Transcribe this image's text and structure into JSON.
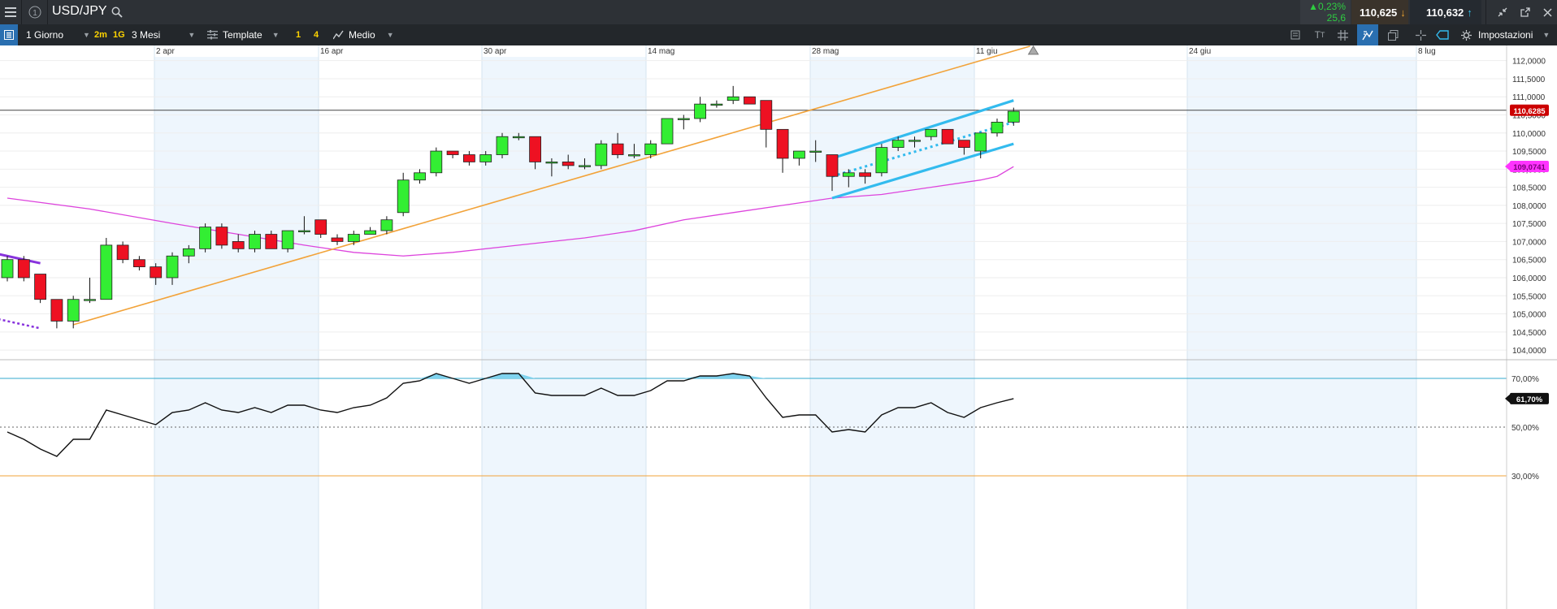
{
  "header": {
    "symbol": "USD/JPY",
    "change_pct": "▲0,23%",
    "change_pts": "25,6",
    "sell_price": "110,625",
    "buy_price": "110,632"
  },
  "toolbar": {
    "interval": "1 Giorno",
    "quick_2m": "2m",
    "quick_1g": "1G",
    "range": "3 Mesi",
    "template": "Template",
    "badge_1": "1",
    "badge_4": "4",
    "style": "Medio",
    "settings": "Impostazioni"
  },
  "icons": [
    "menu-icon",
    "info-icon",
    "search-icon",
    "list-icon",
    "template-icon",
    "chart-style-icon",
    "text-icon",
    "grid-icon",
    "draw-icon",
    "copy-icon",
    "crosshair-icon",
    "label-icon",
    "gear-icon",
    "minimize-icon",
    "popout-icon",
    "close-icon"
  ],
  "colors": {
    "up_candle": "#33ee33",
    "down_candle": "#ee1122",
    "trendline": "#f2a33a",
    "moving_average": "#dd44dd",
    "channel": "#33bbee",
    "price_label": "#cc0000",
    "ma_label": "#ff33ff",
    "oscillator": "#111111",
    "shade": "#eef6fd"
  },
  "chart_data": {
    "type": "candlestick",
    "symbol": "USD/JPY",
    "x_labels": [
      "2 apr",
      "16 apr",
      "30 apr",
      "14 mag",
      "28 mag",
      "11 giu",
      "24 giu",
      "8 lug"
    ],
    "y_ticks": [
      "112,0000",
      "111,5000",
      "111,0000",
      "110,5000",
      "110,0000",
      "109,5000",
      "109,0000",
      "108,5000",
      "108,0000",
      "107,5000",
      "107,0000",
      "106,5000",
      "106,0000",
      "105,5000",
      "105,0000",
      "104,5000",
      "104,0000"
    ],
    "ylim": [
      103.8,
      112.15
    ],
    "current_price_label": "110,6285",
    "current_price": 110.6285,
    "ma_label": "109,0741",
    "ma_value": 109.074,
    "candles": [
      {
        "o": 106.0,
        "h": 106.6,
        "l": 105.9,
        "c": 106.5
      },
      {
        "o": 106.5,
        "h": 106.6,
        "l": 105.9,
        "c": 106.0
      },
      {
        "o": 106.1,
        "h": 106.1,
        "l": 105.3,
        "c": 105.4
      },
      {
        "o": 105.4,
        "h": 105.4,
        "l": 104.6,
        "c": 104.8
      },
      {
        "o": 104.8,
        "h": 105.5,
        "l": 104.6,
        "c": 105.4
      },
      {
        "o": 105.4,
        "h": 106.0,
        "l": 105.3,
        "c": 105.4
      },
      {
        "o": 105.4,
        "h": 107.1,
        "l": 105.4,
        "c": 106.9
      },
      {
        "o": 106.9,
        "h": 107.0,
        "l": 106.4,
        "c": 106.5
      },
      {
        "o": 106.5,
        "h": 106.6,
        "l": 106.2,
        "c": 106.3
      },
      {
        "o": 106.3,
        "h": 106.4,
        "l": 105.8,
        "c": 106.0
      },
      {
        "o": 106.0,
        "h": 106.7,
        "l": 105.8,
        "c": 106.6
      },
      {
        "o": 106.6,
        "h": 106.9,
        "l": 106.4,
        "c": 106.8
      },
      {
        "o": 106.8,
        "h": 107.5,
        "l": 106.7,
        "c": 107.4
      },
      {
        "o": 107.4,
        "h": 107.5,
        "l": 106.8,
        "c": 106.9
      },
      {
        "o": 107.0,
        "h": 107.2,
        "l": 106.7,
        "c": 106.8
      },
      {
        "o": 106.8,
        "h": 107.3,
        "l": 106.7,
        "c": 107.2
      },
      {
        "o": 107.2,
        "h": 107.3,
        "l": 106.8,
        "c": 106.8
      },
      {
        "o": 106.8,
        "h": 107.3,
        "l": 106.7,
        "c": 107.3
      },
      {
        "o": 107.3,
        "h": 107.7,
        "l": 107.2,
        "c": 107.3
      },
      {
        "o": 107.6,
        "h": 107.6,
        "l": 107.1,
        "c": 107.2
      },
      {
        "o": 107.1,
        "h": 107.2,
        "l": 106.9,
        "c": 107.0
      },
      {
        "o": 107.0,
        "h": 107.3,
        "l": 106.9,
        "c": 107.2
      },
      {
        "o": 107.2,
        "h": 107.4,
        "l": 107.2,
        "c": 107.3
      },
      {
        "o": 107.3,
        "h": 107.7,
        "l": 107.2,
        "c": 107.6
      },
      {
        "o": 107.8,
        "h": 108.9,
        "l": 107.7,
        "c": 108.7
      },
      {
        "o": 108.7,
        "h": 109.0,
        "l": 108.6,
        "c": 108.9
      },
      {
        "o": 108.9,
        "h": 109.6,
        "l": 108.8,
        "c": 109.5
      },
      {
        "o": 109.5,
        "h": 109.5,
        "l": 109.3,
        "c": 109.4
      },
      {
        "o": 109.4,
        "h": 109.5,
        "l": 109.1,
        "c": 109.2
      },
      {
        "o": 109.2,
        "h": 109.5,
        "l": 109.1,
        "c": 109.4
      },
      {
        "o": 109.4,
        "h": 110.0,
        "l": 109.3,
        "c": 109.9
      },
      {
        "o": 109.9,
        "h": 110.0,
        "l": 109.8,
        "c": 109.9
      },
      {
        "o": 109.9,
        "h": 109.9,
        "l": 109.0,
        "c": 109.2
      },
      {
        "o": 109.2,
        "h": 109.3,
        "l": 108.8,
        "c": 109.2
      },
      {
        "o": 109.2,
        "h": 109.4,
        "l": 109.0,
        "c": 109.1
      },
      {
        "o": 109.1,
        "h": 109.3,
        "l": 109.0,
        "c": 109.1
      },
      {
        "o": 109.1,
        "h": 109.8,
        "l": 109.0,
        "c": 109.7
      },
      {
        "o": 109.7,
        "h": 110.0,
        "l": 109.3,
        "c": 109.4
      },
      {
        "o": 109.4,
        "h": 109.7,
        "l": 109.3,
        "c": 109.4
      },
      {
        "o": 109.4,
        "h": 109.8,
        "l": 109.3,
        "c": 109.7
      },
      {
        "o": 109.7,
        "h": 110.4,
        "l": 109.7,
        "c": 110.4
      },
      {
        "o": 110.4,
        "h": 110.5,
        "l": 110.1,
        "c": 110.4
      },
      {
        "o": 110.4,
        "h": 111.0,
        "l": 110.3,
        "c": 110.8
      },
      {
        "o": 110.8,
        "h": 110.9,
        "l": 110.7,
        "c": 110.8
      },
      {
        "o": 110.9,
        "h": 111.3,
        "l": 110.8,
        "c": 111.0
      },
      {
        "o": 111.0,
        "h": 111.0,
        "l": 110.8,
        "c": 110.8
      },
      {
        "o": 110.9,
        "h": 110.9,
        "l": 109.6,
        "c": 110.1
      },
      {
        "o": 110.1,
        "h": 110.1,
        "l": 108.9,
        "c": 109.3
      },
      {
        "o": 109.3,
        "h": 109.5,
        "l": 109.1,
        "c": 109.5
      },
      {
        "o": 109.5,
        "h": 109.8,
        "l": 109.2,
        "c": 109.5
      },
      {
        "o": 109.4,
        "h": 109.4,
        "l": 108.4,
        "c": 108.8
      },
      {
        "o": 108.8,
        "h": 109.0,
        "l": 108.5,
        "c": 108.9
      },
      {
        "o": 108.9,
        "h": 109.0,
        "l": 108.6,
        "c": 108.8
      },
      {
        "o": 108.9,
        "h": 109.7,
        "l": 108.8,
        "c": 109.6
      },
      {
        "o": 109.6,
        "h": 109.9,
        "l": 109.5,
        "c": 109.8
      },
      {
        "o": 109.8,
        "h": 109.9,
        "l": 109.6,
        "c": 109.8
      },
      {
        "o": 109.9,
        "h": 110.1,
        "l": 109.8,
        "c": 110.1
      },
      {
        "o": 110.1,
        "h": 110.1,
        "l": 109.7,
        "c": 109.7
      },
      {
        "o": 109.8,
        "h": 109.8,
        "l": 109.4,
        "c": 109.6
      },
      {
        "o": 109.5,
        "h": 110.0,
        "l": 109.3,
        "c": 110.0
      },
      {
        "o": 110.0,
        "h": 110.4,
        "l": 109.9,
        "c": 110.3
      },
      {
        "o": 110.3,
        "h": 110.7,
        "l": 110.2,
        "c": 110.6
      }
    ],
    "moving_average": [
      [
        0,
        108.2
      ],
      [
        5,
        107.9
      ],
      [
        10,
        107.5
      ],
      [
        14,
        107.2
      ],
      [
        18,
        106.9
      ],
      [
        21,
        106.7
      ],
      [
        24,
        106.6
      ],
      [
        27,
        106.7
      ],
      [
        31,
        106.9
      ],
      [
        35,
        107.1
      ],
      [
        38,
        107.3
      ],
      [
        41,
        107.6
      ],
      [
        44,
        107.8
      ],
      [
        47,
        108.0
      ],
      [
        50,
        108.2
      ],
      [
        53,
        108.3
      ],
      [
        56,
        108.5
      ],
      [
        59,
        108.7
      ],
      [
        60,
        108.8
      ],
      [
        61,
        109.07
      ]
    ],
    "oscillator_levels": [
      "70,00%",
      "50,00%",
      "30,00%"
    ],
    "oscillator_ylim": [
      24,
      76
    ],
    "oscillator_value_label": "61,70%",
    "oscillator": [
      48,
      45,
      41,
      38,
      45,
      45,
      57,
      55,
      53,
      51,
      56,
      57,
      60,
      57,
      56,
      58,
      56,
      59,
      59,
      57,
      56,
      58,
      59,
      62,
      68,
      69,
      72,
      70,
      68,
      70,
      72,
      72,
      64,
      63,
      63,
      63,
      66,
      63,
      63,
      65,
      69,
      69,
      71,
      71,
      72,
      71,
      62,
      54,
      55,
      55,
      48,
      49,
      48,
      55,
      58,
      58,
      60,
      56,
      54,
      58,
      60,
      61.7
    ],
    "drawings": {
      "orange_trendline": {
        "from": [
          4,
          104.7
        ],
        "to": [
          62,
          112.4
        ]
      },
      "channel_upper": {
        "from": [
          50,
          109.3
        ],
        "to": [
          61,
          110.9
        ]
      },
      "channel_lower": {
        "from": [
          50,
          108.2
        ],
        "to": [
          61,
          109.7
        ]
      },
      "channel_mid_dotted": {
        "from": [
          50,
          108.8
        ],
        "to": [
          61,
          110.3
        ]
      },
      "purple_solid": {
        "from": [
          -2,
          106.8
        ],
        "to": [
          2,
          106.4
        ]
      },
      "purple_dotted": {
        "from": [
          -2,
          105.0
        ],
        "to": [
          2,
          104.6
        ]
      }
    }
  }
}
